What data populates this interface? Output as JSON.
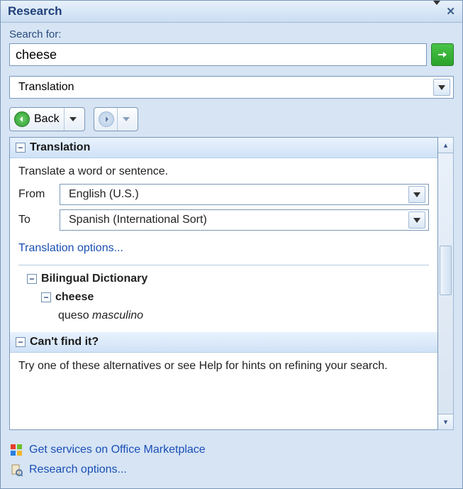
{
  "title": "Research",
  "search": {
    "label": "Search for:",
    "value": "cheese"
  },
  "service": {
    "selected": "Translation"
  },
  "nav": {
    "back_label": "Back"
  },
  "results": {
    "translation": {
      "header": "Translation",
      "prompt": "Translate a word or sentence.",
      "from_label": "From",
      "to_label": "To",
      "from_value": "English (U.S.)",
      "to_value": "Spanish (International Sort)",
      "options_link": "Translation options...",
      "bilingual": {
        "header": "Bilingual Dictionary",
        "entry": "cheese",
        "definition": "queso",
        "pos": "masculino"
      }
    },
    "cant_find": {
      "header": "Can't find it?",
      "text": "Try one of these alternatives or see Help for hints on refining your search."
    }
  },
  "footer": {
    "marketplace": "Get services on Office Marketplace",
    "options": "Research options..."
  }
}
